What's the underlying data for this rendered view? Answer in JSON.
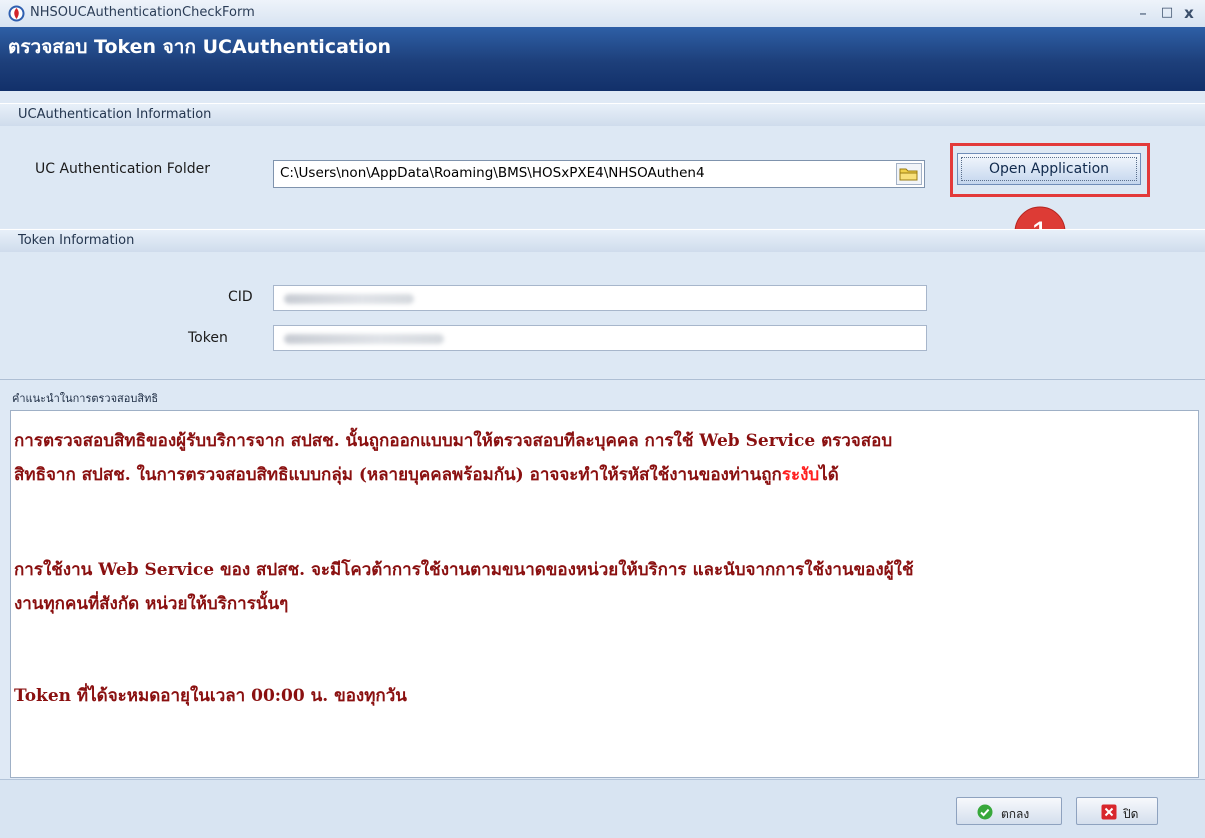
{
  "window": {
    "title": "NHSOUCAuthenticationCheckForm",
    "minimize": "–",
    "maximize": "□",
    "close": "x"
  },
  "banner": {
    "title": "ตรวจสอบ Token จาก UCAuthentication"
  },
  "uc_section": {
    "header": "UCAuthentication Information",
    "folder_label": "UC Authentication Folder",
    "folder_value": "C:\\Users\\non\\AppData\\Roaming\\BMS\\HOSxPXE4\\NHSOAuthen4",
    "open_button": "Open Application"
  },
  "annotation": {
    "step_number": "1",
    "highlight_color": "#e33a3a"
  },
  "token_section": {
    "header": "Token Information",
    "cid_label": "CID",
    "token_label": "Token"
  },
  "advice": {
    "header": "คำแนะนำในการตรวจสอบสิทธิ",
    "line1": "การตรวจสอบสิทธิของผู้รับบริการจาก สปสช. นั้นถูกออกแบบมาให้ตรวจสอบทีละบุคคล การใช้ Web Service ตรวจสอบ",
    "line2a": "สิทธิจาก สปสช. ในการตรวจสอบสิทธิแบบกลุ่ม (หลายบุคคลพร้อมกัน) อาจจะทำให้รหัสใช้งานของท่านถูก",
    "line2b": "ระงับ",
    "line2c": "ได้",
    "line3": "การใช้งาน Web Service ของ สปสช. จะมีโควต้าการใช้งานตามขนาดของหน่วยให้บริการ และนับจากการใช้งานของผู้ใช้",
    "line4": "งานทุกคนที่สังกัด หน่วยให้บริการนั้นๆ",
    "line5": "Token ที่ได้จะหมดอายุในเวลา 00:00 น. ของทุกวัน"
  },
  "footer": {
    "ok_label": "ตกลง",
    "close_label": "ปิด"
  }
}
